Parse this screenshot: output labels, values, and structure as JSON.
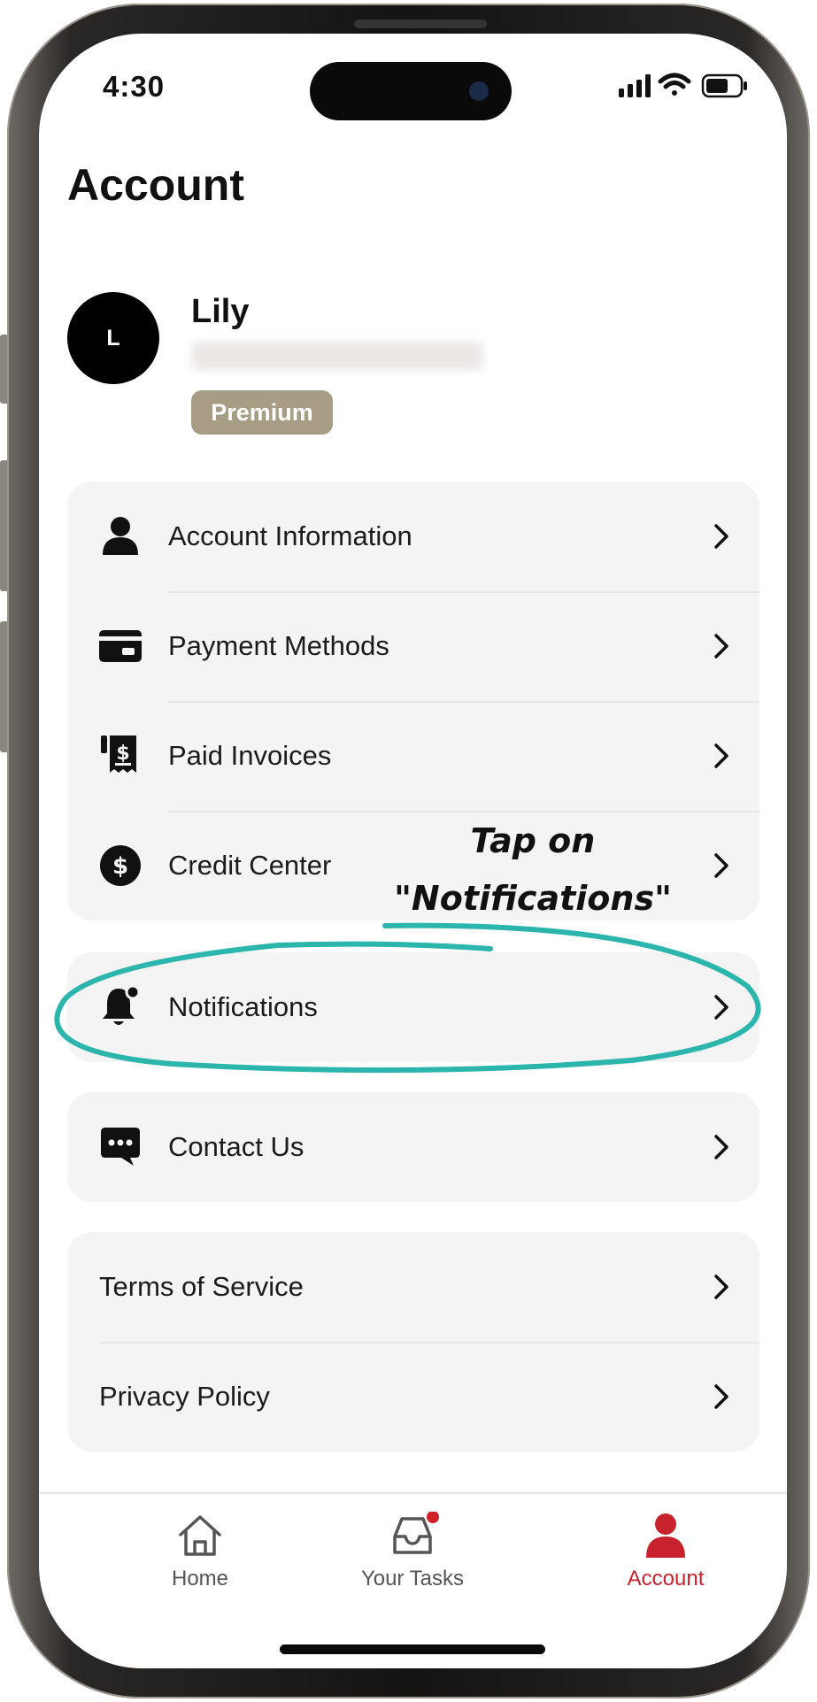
{
  "status_bar": {
    "time": "4:30"
  },
  "page": {
    "title": "Account"
  },
  "profile": {
    "avatar_initial": "L",
    "name": "Lily",
    "badge": "Premium"
  },
  "menu_groups": {
    "account": [
      {
        "label": "Account Information",
        "icon": "person-icon"
      },
      {
        "label": "Payment Methods",
        "icon": "credit-card-icon"
      },
      {
        "label": "Paid Invoices",
        "icon": "receipt-icon"
      },
      {
        "label": "Credit Center",
        "icon": "dollar-circle-icon"
      }
    ],
    "notifications": {
      "label": "Notifications",
      "icon": "bell-icon"
    },
    "support": {
      "label": "Contact Us",
      "icon": "chat-bubble-icon"
    },
    "legal": [
      {
        "label": "Terms of Service"
      },
      {
        "label": "Privacy Policy"
      }
    ]
  },
  "annotation": {
    "line1": "Tap on",
    "line2": "\"Notifications\"",
    "color": "#2bb5ad"
  },
  "bottom_nav": [
    {
      "label": "Home",
      "icon": "home-icon",
      "active": false
    },
    {
      "label": "Your Tasks",
      "icon": "inbox-icon",
      "active": false,
      "has_dot": true
    },
    {
      "label": "Account",
      "icon": "person-icon",
      "active": true
    }
  ],
  "colors": {
    "accent": "#c8232c",
    "badge": "#a79d85",
    "card_bg": "#f4f4f4",
    "annotation": "#2bb5ad"
  }
}
